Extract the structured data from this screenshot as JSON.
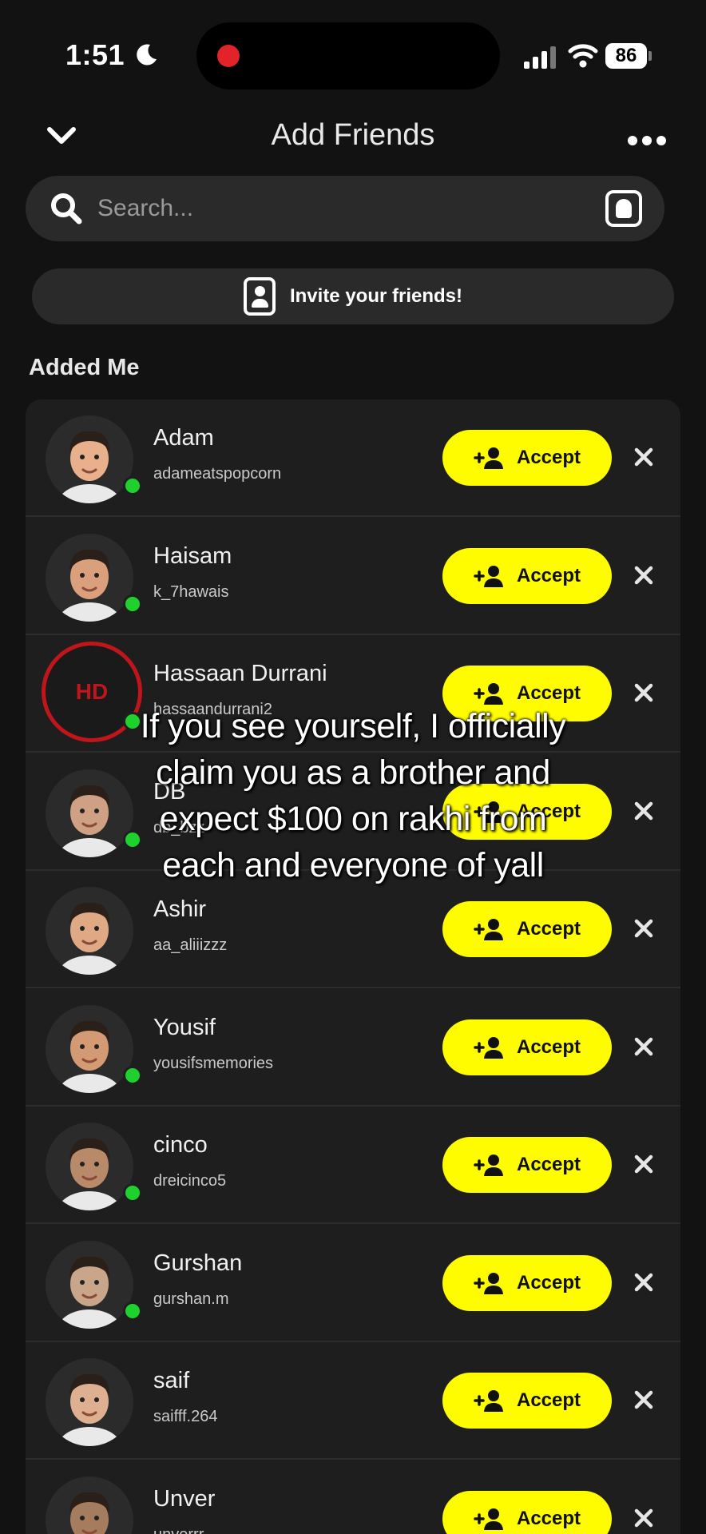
{
  "status_bar": {
    "time": "1:51",
    "battery": "86"
  },
  "header": {
    "title": "Add Friends"
  },
  "search": {
    "placeholder": "Search..."
  },
  "invite": {
    "label": "Invite your friends!"
  },
  "section": {
    "title": "Added Me"
  },
  "accept_label": "Accept",
  "requests": [
    {
      "name": "Adam",
      "username": "adameatspopcorn",
      "online": true
    },
    {
      "name": "Haisam",
      "username": "k_7hawais",
      "online": true
    },
    {
      "name": "Hassaan Durrani",
      "username": "hassaandurrani2",
      "online": true,
      "avatar_text": "HD"
    },
    {
      "name": "DB",
      "username": "db_bzz",
      "online": true
    },
    {
      "name": "Ashir",
      "username": "aa_aliiizzz",
      "online": false
    },
    {
      "name": "Yousif",
      "username": "yousifsmemories",
      "online": true
    },
    {
      "name": "cinco",
      "username": "dreicinco5",
      "online": true
    },
    {
      "name": "Gurshan",
      "username": "gurshan.m",
      "online": true
    },
    {
      "name": "saif",
      "username": "saifff.264",
      "online": false
    },
    {
      "name": "Unver",
      "username": "unverrr",
      "online": false
    }
  ],
  "overlay": {
    "caption": "If you see yourself, I officially claim you as a brother and expect $100 on rakhi from each and everyone of yall"
  },
  "colors": {
    "accent": "#fffc00",
    "online": "#1fd12c",
    "background": "#121212"
  }
}
